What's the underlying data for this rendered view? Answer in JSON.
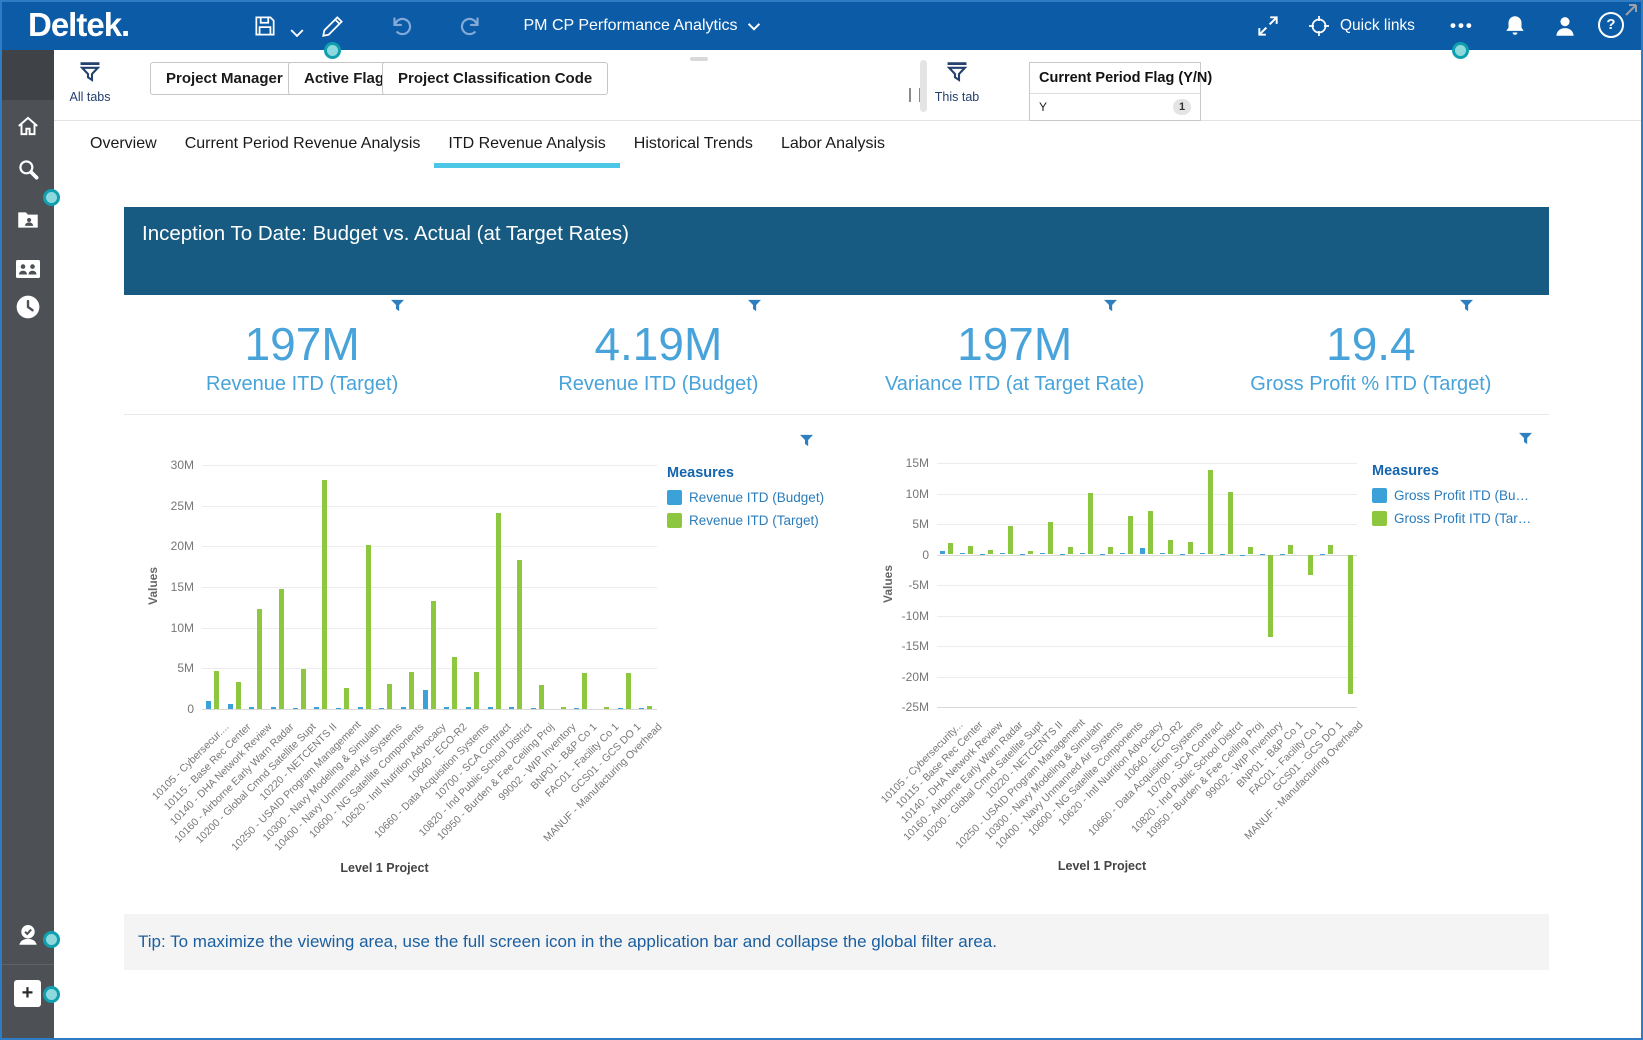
{
  "header": {
    "logo": "Deltek.",
    "title": "PM CP Performance Analytics",
    "quick_links_label": "Quick links",
    "icons": [
      "save-icon",
      "edit-icon",
      "undo-icon",
      "redo-icon",
      "fullscreen-icon",
      "quick-links-icon",
      "more-icon",
      "notifications-icon",
      "user-icon",
      "help-icon"
    ],
    "help_glyph": "?",
    "more_glyph": "•••"
  },
  "sidebar": {
    "icons": [
      "home-icon",
      "search-icon",
      "project-folder-icon",
      "contacts-icon",
      "history-icon",
      "approvals-icon",
      "add-icon"
    ],
    "add_glyph": "+"
  },
  "filters": {
    "all_tabs_label": "All tabs",
    "this_tab_label": "This tab",
    "buttons": [
      "Project Manager",
      "Active Flag",
      "Project Classification Code"
    ],
    "current": {
      "title": "Current Period Flag (Y/N)",
      "value": "Y",
      "count": "1"
    }
  },
  "tabs": {
    "items": [
      "Overview",
      "Current Period Revenue Analysis",
      "ITD Revenue Analysis",
      "Historical Trends",
      "Labor Analysis"
    ],
    "active_index": 2
  },
  "banner": {
    "title": "Inception To Date:  Budget vs. Actual (at Target Rates)"
  },
  "kpis": [
    {
      "value": "197M",
      "label": "Revenue ITD (Target)"
    },
    {
      "value": "4.19M",
      "label": "Revenue ITD (Budget)"
    },
    {
      "value": "197M",
      "label": "Variance ITD (at Target Rate)"
    },
    {
      "value": "19.4",
      "label": "Gross Profit % ITD (Target)"
    }
  ],
  "colors": {
    "header_blue": "#0b5ba7",
    "banner_blue": "#175b82",
    "kpi_blue": "#47a3d9",
    "bar_blue": "#3ba1d9",
    "bar_green": "#8dc63f",
    "tab_underline": "#4cc6e6",
    "teal_dot": "#0f9fae",
    "funnel_blue": "#2e7fc0",
    "tip_text": "#1b5fa0"
  },
  "chart_data": [
    {
      "type": "bar",
      "title": "",
      "xlabel": "Level 1 Project",
      "ylabel": "Values",
      "legend_title": "Measures",
      "legend_position": "right",
      "grid": true,
      "unit": "millions",
      "ylim": [
        0,
        30
      ],
      "yticks": [
        {
          "v": 0,
          "label": "0"
        },
        {
          "v": 5,
          "label": "5M"
        },
        {
          "v": 10,
          "label": "10M"
        },
        {
          "v": 15,
          "label": "15M"
        },
        {
          "v": 20,
          "label": "20M"
        },
        {
          "v": 25,
          "label": "25M"
        },
        {
          "v": 30,
          "label": "30M"
        }
      ],
      "categories": [
        "10105 - Cybersecur....",
        "10115 - Base Rec Center",
        "10140 - DHA Network Review",
        "10160 - Airborne Early Warn Radar",
        "10200 - Global Cmnd Satellite Supt",
        "10220 - NETCENTS II",
        "10250 - USAID Program Management",
        "10300 - Navy Modeling & Simulatn",
        "10400 - Navy Unmanned Air Systems",
        "10600 - NG Satellite Components",
        "10620 - Intl Nutrition Advocacy",
        "10640 - ECO-R2",
        "10660 - Data Acquisition Systems",
        "10700 - SCA Contract",
        "10820 - Ind Public School District",
        "10950 - Burden & Fee Ceiling Proj",
        "99002 - WIP Inventory",
        "BNP01 - B&P Co 1",
        "FAC01 - Facility Co 1",
        "GCS01 - GCS DO 1",
        "MANUF - Manufacturing Overhead"
      ],
      "series": [
        {
          "name": "Revenue ITD (Budget)",
          "color": "#3ba1d9",
          "values": [
            1.0,
            0.6,
            0.2,
            0.2,
            0.1,
            0.2,
            0.1,
            0.3,
            0.1,
            0.2,
            2.3,
            0.3,
            0.2,
            0.3,
            0.2,
            0.1,
            0,
            0.1,
            0,
            0.1,
            0.1
          ]
        },
        {
          "name": "Revenue ITD (Target)",
          "color": "#8dc63f",
          "values": [
            4.7,
            3.3,
            12.3,
            14.8,
            4.9,
            28.2,
            2.6,
            20.2,
            3.1,
            4.5,
            13.3,
            6.4,
            4.6,
            24.1,
            18.3,
            2.9,
            0.3,
            4.4,
            0.2,
            4.4,
            0.4
          ]
        }
      ]
    },
    {
      "type": "bar",
      "title": "",
      "xlabel": "Level 1 Project",
      "ylabel": "Values",
      "legend_title": "Measures",
      "legend_position": "right",
      "grid": true,
      "unit": "millions",
      "ylim": [
        -25,
        15
      ],
      "yticks": [
        {
          "v": -25,
          "label": "-25M"
        },
        {
          "v": -20,
          "label": "-20M"
        },
        {
          "v": -15,
          "label": "-15M"
        },
        {
          "v": -10,
          "label": "-10M"
        },
        {
          "v": -5,
          "label": "-5M"
        },
        {
          "v": 0,
          "label": "0"
        },
        {
          "v": 5,
          "label": "5M"
        },
        {
          "v": 10,
          "label": "10M"
        },
        {
          "v": 15,
          "label": "15M"
        }
      ],
      "categories": [
        "10105 - Cybersecurity...",
        "10115 - Base Rec Center",
        "10140 - DHA Network Review",
        "10160 - Airborne Early Warn Radar",
        "10200 - Global Cmnd Satellite Supt",
        "10220 - NETCENTS II",
        "10250 - USAID Program Management",
        "10300 - Navy Modeling & Simulatn",
        "10400 - Navy Unmanned Air Systems",
        "10600 - NG Satellite Components",
        "10620 - Intl Nutrition Advocacy",
        "10640 - ECO-R2",
        "10660 - Data Acquisition Systems",
        "10700 - SCA Contract",
        "10820 - Ind Public School Distrct",
        "10950 - Burden & Fee Ceiling Proj",
        "99002 - WIP Inventory",
        "BNP01 - B&P Co 1",
        "FAC01 - Facility Co 1",
        "GCS01 - GCS DO 1",
        "MANUF - Manufacturing Overhead"
      ],
      "series": [
        {
          "name": "Gross Profit ITD (Bu…",
          "color": "#3ba1d9",
          "values": [
            0.5,
            0.3,
            0.1,
            0.2,
            0.1,
            0.2,
            0.1,
            0.2,
            0.1,
            0.2,
            1.0,
            0.2,
            0.1,
            0.2,
            0.1,
            -0.2,
            0.1,
            0.1,
            0,
            0.1,
            0
          ]
        },
        {
          "name": "Gross Profit ITD (Tar…",
          "color": "#8dc63f",
          "values": [
            1.9,
            1.4,
            0.7,
            4.6,
            0.6,
            5.4,
            1.2,
            10.1,
            1.3,
            6.3,
            7.1,
            2.4,
            2.0,
            13.9,
            10.3,
            1.2,
            -13.6,
            1.5,
            -3.4,
            1.5,
            -22.8
          ]
        }
      ]
    }
  ],
  "tip": {
    "text": "Tip:  To maximize the viewing area, use the full screen icon in the application bar and collapse the global filter area."
  }
}
